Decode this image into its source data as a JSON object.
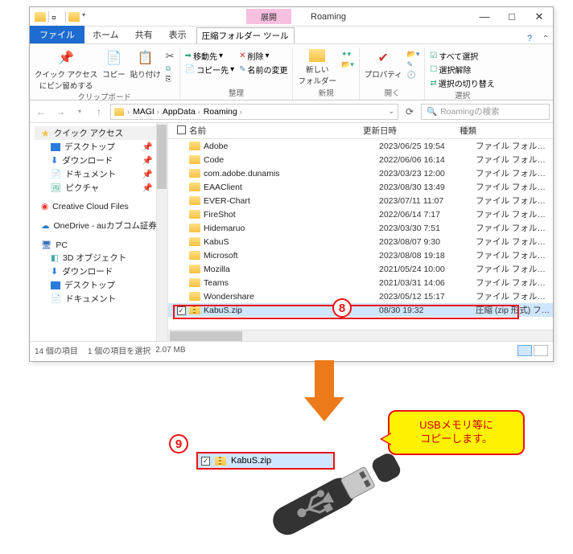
{
  "window": {
    "contextual_tab": "展開",
    "title": "Roaming"
  },
  "win_controls": {
    "min": "—",
    "max": "□",
    "close": "✕"
  },
  "tabs": {
    "file": "ファイル",
    "home": "ホーム",
    "share": "共有",
    "view": "表示",
    "compressed": "圧縮フォルダー ツール"
  },
  "ribbon": {
    "pin": "クイック アクセス\nにピン留めする",
    "copy": "コピー",
    "paste": "貼り付け",
    "cut": "✂",
    "copypath": "⧉",
    "shortcut": "⎘",
    "clipboard_label": "クリップボード",
    "move": "移動先",
    "copyto": "コピー先",
    "delete": "削除",
    "rename": "名前の変更",
    "organize_label": "整理",
    "newfolder": "新しい\nフォルダー",
    "new_label": "新規",
    "properties": "プロパティ",
    "open_label": "開く",
    "selectall": "すべて選択",
    "selectnone": "選択解除",
    "invert": "選択の切り替え",
    "select_label": "選択"
  },
  "breadcrumbs": [
    "MAGI",
    "AppData",
    "Roaming"
  ],
  "search_placeholder": "Roamingの検索",
  "sidebar": {
    "quick": "クイック アクセス",
    "desktop": "デスクトップ",
    "downloads": "ダウンロード",
    "documents": "ドキュメント",
    "pictures": "ピクチャ",
    "creativecloud": "Creative Cloud Files",
    "onedrive": "OneDrive - auカブコム証券",
    "pc": "PC",
    "threed": "3D オブジェクト",
    "downloads2": "ダウンロード",
    "desktop2": "デスクトップ",
    "documents2": "ドキュメント"
  },
  "columns": {
    "name": "名前",
    "date": "更新日時",
    "type": "種類"
  },
  "items": [
    {
      "name": "Adobe",
      "date": "2023/06/25 19:54",
      "type": "ファイル フォルダー"
    },
    {
      "name": "Code",
      "date": "2022/06/06 16:14",
      "type": "ファイル フォルダー"
    },
    {
      "name": "com.adobe.dunamis",
      "date": "2023/03/23 12:00",
      "type": "ファイル フォルダー"
    },
    {
      "name": "EAAClient",
      "date": "2023/08/30 13:49",
      "type": "ファイル フォルダー"
    },
    {
      "name": "EVER-Chart",
      "date": "2023/07/11 11:07",
      "type": "ファイル フォルダー"
    },
    {
      "name": "FireShot",
      "date": "2022/06/14 7:17",
      "type": "ファイル フォルダー"
    },
    {
      "name": "Hidemaruo",
      "date": "2023/03/30 7:51",
      "type": "ファイル フォルダー"
    },
    {
      "name": "KabuS",
      "date": "2023/08/07 9:30",
      "type": "ファイル フォルダー"
    },
    {
      "name": "Microsoft",
      "date": "2023/08/08 19:18",
      "type": "ファイル フォルダー"
    },
    {
      "name": "Mozilla",
      "date": "2021/05/24 10:00",
      "type": "ファイル フォルダー"
    },
    {
      "name": "Teams",
      "date": "2021/03/31 14:06",
      "type": "ファイル フォルダー"
    },
    {
      "name": "Wondershare",
      "date": "2023/05/12 15:17",
      "type": "ファイル フォルダー"
    },
    {
      "name": "KabuS.zip",
      "date": "08/30 19:32",
      "type": "圧縮 (zip 形式) フォ...",
      "selected": true,
      "zip": true
    }
  ],
  "status": {
    "count": "14 個の項目",
    "sel": "1 個の項目を選択",
    "size": "2.07 MB"
  },
  "callouts": {
    "c8": "8",
    "c9": "9",
    "speech": "USBメモリ等に\nコピーします。",
    "usb_file": "KabuS.zip"
  }
}
